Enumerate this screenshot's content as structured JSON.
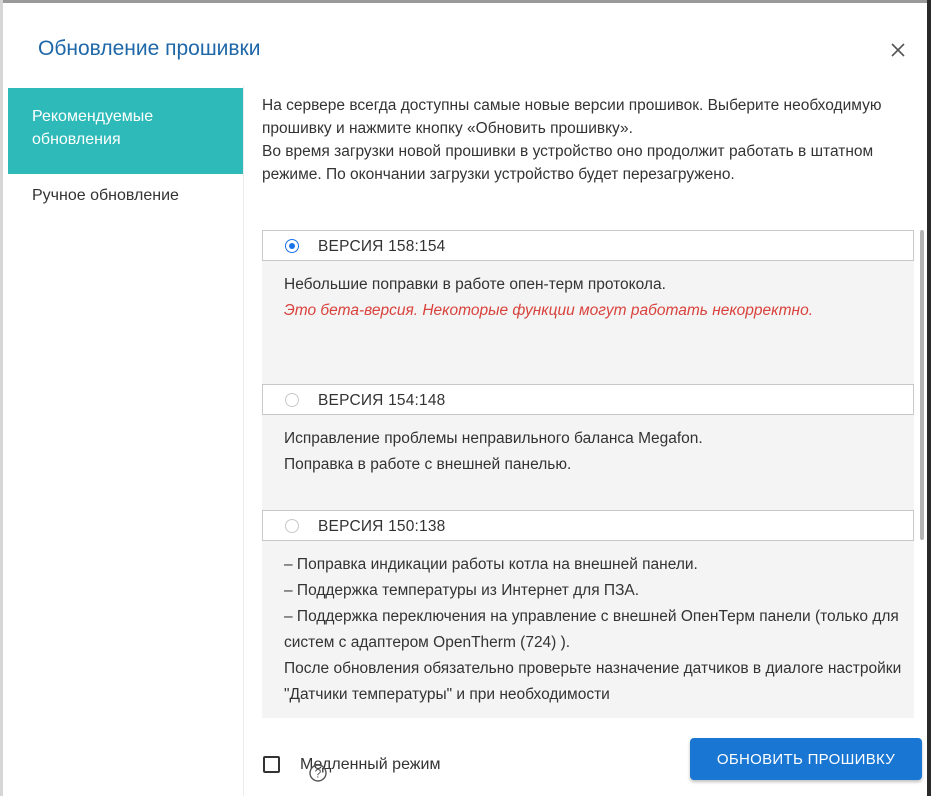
{
  "dialog": {
    "title": "Обновление прошивки",
    "close_icon": "close-icon"
  },
  "sidebar": {
    "items": [
      {
        "label": "Рекомендуемые обновления",
        "active": true
      },
      {
        "label": "Ручное обновление",
        "active": false
      }
    ]
  },
  "intro": {
    "line1": "На сервере всегда доступны самые новые версии прошивок. Выберите необходимую прошивку и нажмите кнопку «Обновить прошивку».",
    "line2": "Во время загрузки новой прошивки в устройство оно продолжит работать в штатном режиме. По окончании загрузки устройство будет перезагружено."
  },
  "versions": [
    {
      "label": "ВЕРСИЯ 158:154",
      "selected": true,
      "description": "Небольшие поправки в работе опен-терм протокола.",
      "warning": "Это бета-версия. Некоторые функции могут работать некорректно."
    },
    {
      "label": "ВЕРСИЯ 154:148",
      "selected": false,
      "lines": [
        "Исправление проблемы неправильного баланса Megafon.",
        "Поправка в работе с внешней панелью."
      ]
    },
    {
      "label": "ВЕРСИЯ 150:138",
      "selected": false,
      "lines": [
        "– Поправка индикации работы котла на внешней панели.",
        "– Поддержка температуры из Интернет для ПЗА.",
        "– Поддержка переключения на управление с внешней ОпенТерм панели (только для систем с адаптером OpenTherm (724) ).",
        "После обновления обязательно проверьте назначение датчиков в диалоге настройки \"Датчики температуры\" и при необходимости"
      ]
    }
  ],
  "footer": {
    "slow_mode_label": "Медленный режим",
    "slow_mode_checked": false,
    "help_icon": "help-circle-icon",
    "update_button_label": "ОБНОВИТЬ ПРОШИВКУ"
  },
  "colors": {
    "accent_teal": "#2dbab9",
    "primary_blue": "#1976d2",
    "title_blue": "#1e67a8",
    "warning_red": "#d9423c"
  }
}
